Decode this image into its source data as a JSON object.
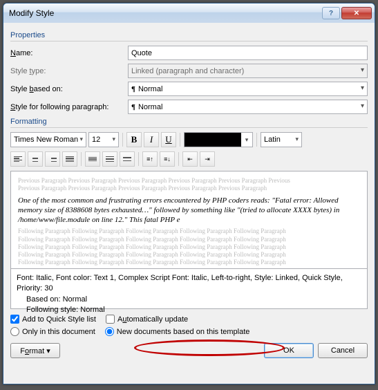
{
  "title": "Modify Style",
  "sections": {
    "properties": "Properties",
    "formatting": "Formatting"
  },
  "labels": {
    "name": "Name:",
    "styleType": "Style type:",
    "basedOn": "Style based on:",
    "following": "Style for following paragraph:"
  },
  "fields": {
    "name": "Quote",
    "styleType": "Linked (paragraph and character)",
    "basedOn": "Normal",
    "following": "Normal"
  },
  "format": {
    "font": "Times New Roman",
    "size": "12",
    "script": "Latin"
  },
  "preview": {
    "grayPrev": "Previous Paragraph Previous Paragraph Previous Paragraph Previous Paragraph Previous Paragraph Previous",
    "grayPrev2": "Previous Paragraph Previous Paragraph Previous Paragraph Previous Paragraph Previous Paragraph",
    "main": "One of the most common and frustrating errors encountered by PHP coders reads: \"Fatal error: Allowed memory size of 8388608 bytes exhausted…\" followed by something like \"(tried to allocate XXXX bytes) in /home/www/file.module on line 12.\" This fatal PHP e",
    "grayFoll": "Following Paragraph Following Paragraph Following Paragraph Following Paragraph Following Paragraph"
  },
  "desc": {
    "line1": "Font: Italic, Font color: Text 1, Complex Script Font: Italic, Left-to-right, Style: Linked, Quick Style, Priority: 30",
    "line2": "Based on: Normal",
    "line3": "Following style: Normal"
  },
  "options": {
    "addQuick": "Add to Quick Style list",
    "autoUpdate": "Automatically update",
    "onlyDoc": "Only in this document",
    "newDocs": "New documents based on this template"
  },
  "buttons": {
    "format": "Format ▾",
    "ok": "OK",
    "cancel": "Cancel"
  }
}
